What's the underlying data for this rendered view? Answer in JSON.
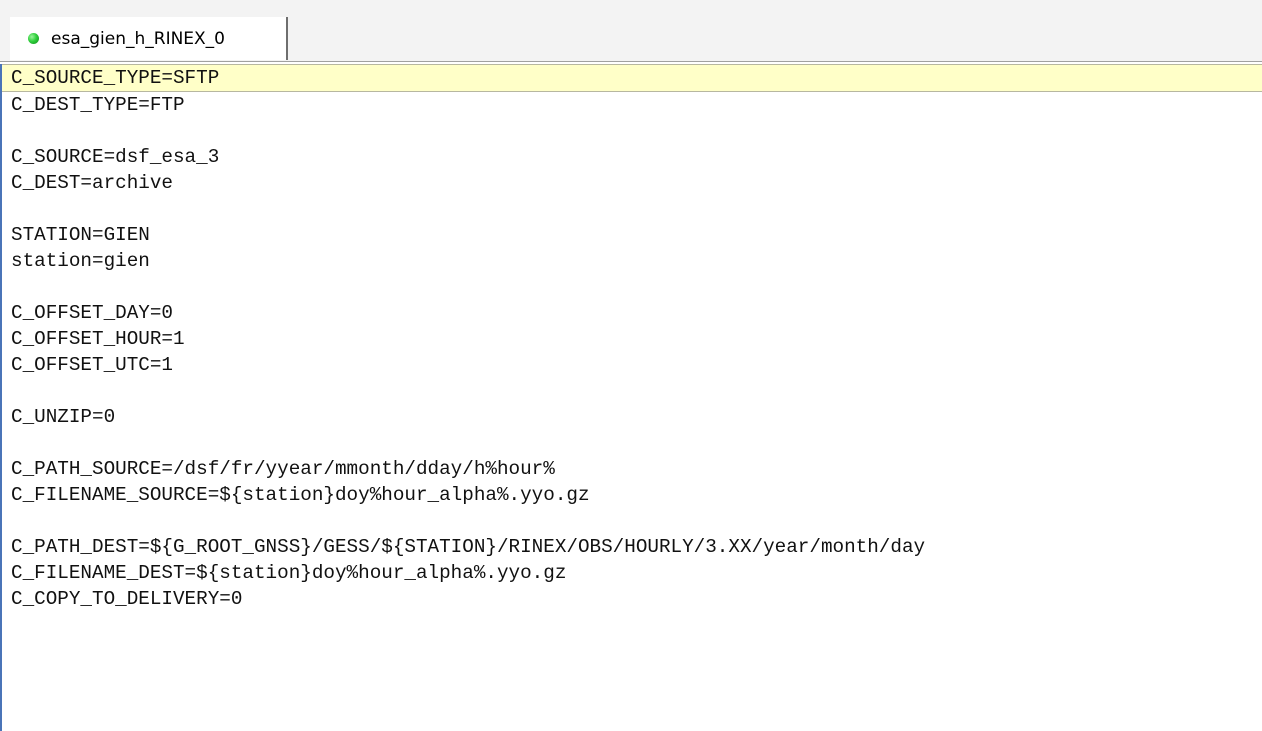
{
  "tab": {
    "label": "esa_gien_h_RINEX_0",
    "status_icon": "green-status-dot-icon",
    "status_color": "#2fcf3c"
  },
  "editor": {
    "current_line_color": "#ffffc8",
    "lines": [
      "C_SOURCE_TYPE=SFTP",
      "C_DEST_TYPE=FTP",
      "",
      "C_SOURCE=dsf_esa_3",
      "C_DEST=archive",
      "",
      "STATION=GIEN",
      "station=gien",
      "",
      "C_OFFSET_DAY=0",
      "C_OFFSET_HOUR=1",
      "C_OFFSET_UTC=1",
      "",
      "C_UNZIP=0",
      "",
      "C_PATH_SOURCE=/dsf/fr/yyear/mmonth/dday/h%hour%",
      "C_FILENAME_SOURCE=${station}doy%hour_alpha%.yyo.gz",
      "",
      "C_PATH_DEST=${G_ROOT_GNSS}/GESS/${STATION}/RINEX/OBS/HOURLY/3.XX/year/month/day",
      "C_FILENAME_DEST=${station}doy%hour_alpha%.yyo.gz",
      "C_COPY_TO_DELIVERY=0"
    ]
  }
}
